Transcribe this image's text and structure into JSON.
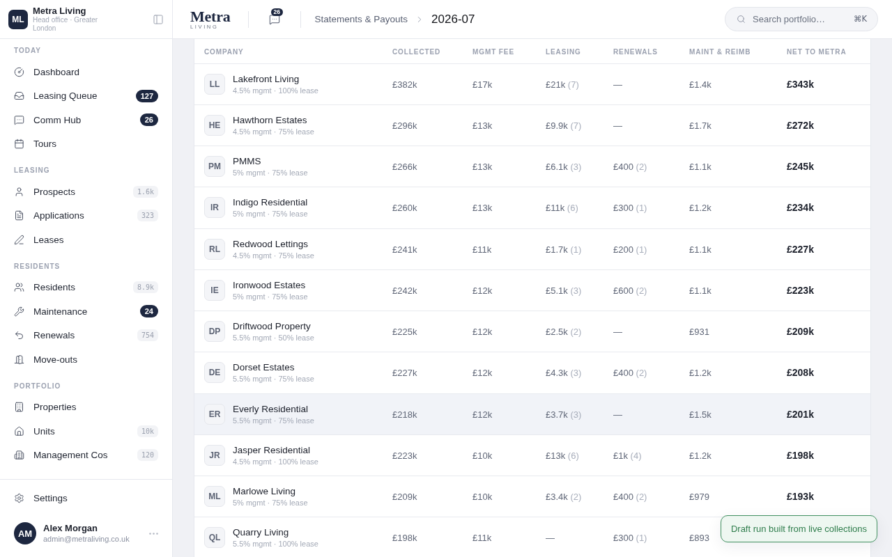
{
  "sidebar": {
    "brand": {
      "initials": "ML",
      "name": "Metra Living",
      "subtitle": "Head office · Greater London"
    },
    "sections": [
      {
        "title": "TODAY",
        "items": [
          {
            "label": "Dashboard",
            "selected": false
          },
          {
            "label": "Leasing Queue",
            "selected": false,
            "badge": {
              "text": "127",
              "kind": "alert"
            }
          },
          {
            "label": "Comm Hub",
            "selected": false,
            "badge": {
              "text": "26",
              "kind": "alert"
            }
          },
          {
            "label": "Tours",
            "selected": false
          }
        ]
      },
      {
        "title": "LEASING",
        "items": [
          {
            "label": "Prospects",
            "selected": false,
            "badge": {
              "text": "1.6k",
              "kind": "count"
            }
          },
          {
            "label": "Applications",
            "selected": false,
            "badge": {
              "text": "323",
              "kind": "count"
            }
          },
          {
            "label": "Leases",
            "selected": false
          }
        ]
      },
      {
        "title": "RESIDENTS",
        "items": [
          {
            "label": "Residents",
            "selected": false,
            "badge": {
              "text": "8.9k",
              "kind": "count"
            }
          },
          {
            "label": "Maintenance",
            "selected": false,
            "badge": {
              "text": "24",
              "kind": "alert"
            }
          },
          {
            "label": "Renewals",
            "selected": false,
            "badge": {
              "text": "754",
              "kind": "count"
            }
          },
          {
            "label": "Move-outs",
            "selected": false
          }
        ]
      },
      {
        "title": "PORTFOLIO",
        "items": [
          {
            "label": "Properties",
            "selected": false
          },
          {
            "label": "Units",
            "selected": false,
            "badge": {
              "text": "10k",
              "kind": "count"
            }
          },
          {
            "label": "Management Cos",
            "selected": false,
            "badge": {
              "text": "120",
              "kind": "count"
            }
          }
        ]
      }
    ],
    "footer_items": [
      {
        "label": "Settings",
        "selected": false
      }
    ],
    "user": {
      "initials": "AM",
      "name": "Alex Morgan",
      "email": "admin@metraliving.co.uk"
    }
  },
  "header": {
    "logo": {
      "name": "Metra",
      "tagline": "LIVING"
    },
    "messages_badge": "26",
    "breadcrumb": [
      {
        "label": "Statements & Payouts",
        "current": false
      },
      {
        "label": "2026-07",
        "current": true
      }
    ],
    "search": {
      "placeholder": "Search portfolio…",
      "shortcut": "⌘K"
    }
  },
  "table": {
    "columns": [
      "COMPANY",
      "COLLECTED",
      "MGMT FEE",
      "LEASING",
      "RENEWALS",
      "MAINT & REIMB",
      "NET TO METRA"
    ],
    "rows": [
      {
        "initials": "LL",
        "name": "Lakefront Living",
        "terms": "4.5% mgmt · 100% lease",
        "collected": "£382k",
        "mgmt_fee": "£17k",
        "leasing": {
          "amount": "£21k",
          "count": "(7)"
        },
        "renewals": {
          "amount": "—"
        },
        "maint_reimb": "£1.4k",
        "net": "£343k",
        "highlighted": false
      },
      {
        "initials": "HE",
        "name": "Hawthorn Estates",
        "terms": "4.5% mgmt · 75% lease",
        "collected": "£296k",
        "mgmt_fee": "£13k",
        "leasing": {
          "amount": "£9.9k",
          "count": "(7)"
        },
        "renewals": {
          "amount": "—"
        },
        "maint_reimb": "£1.7k",
        "net": "£272k",
        "highlighted": false
      },
      {
        "initials": "PM",
        "name": "PMMS",
        "terms": "5% mgmt · 75% lease",
        "collected": "£266k",
        "mgmt_fee": "£13k",
        "leasing": {
          "amount": "£6.1k",
          "count": "(3)"
        },
        "renewals": {
          "amount": "£400",
          "count": "(2)"
        },
        "maint_reimb": "£1.1k",
        "net": "£245k",
        "highlighted": false
      },
      {
        "initials": "IR",
        "name": "Indigo Residential",
        "terms": "5% mgmt · 75% lease",
        "collected": "£260k",
        "mgmt_fee": "£13k",
        "leasing": {
          "amount": "£11k",
          "count": "(6)"
        },
        "renewals": {
          "amount": "£300",
          "count": "(1)"
        },
        "maint_reimb": "£1.2k",
        "net": "£234k",
        "highlighted": false
      },
      {
        "initials": "RL",
        "name": "Redwood Lettings",
        "terms": "4.5% mgmt · 75% lease",
        "collected": "£241k",
        "mgmt_fee": "£11k",
        "leasing": {
          "amount": "£1.7k",
          "count": "(1)"
        },
        "renewals": {
          "amount": "£200",
          "count": "(1)"
        },
        "maint_reimb": "£1.1k",
        "net": "£227k",
        "highlighted": false
      },
      {
        "initials": "IE",
        "name": "Ironwood Estates",
        "terms": "5% mgmt · 75% lease",
        "collected": "£242k",
        "mgmt_fee": "£12k",
        "leasing": {
          "amount": "£5.1k",
          "count": "(3)"
        },
        "renewals": {
          "amount": "£600",
          "count": "(2)"
        },
        "maint_reimb": "£1.1k",
        "net": "£223k",
        "highlighted": false
      },
      {
        "initials": "DP",
        "name": "Driftwood Property",
        "terms": "5.5% mgmt · 50% lease",
        "collected": "£225k",
        "mgmt_fee": "£12k",
        "leasing": {
          "amount": "£2.5k",
          "count": "(2)"
        },
        "renewals": {
          "amount": "—"
        },
        "maint_reimb": "£931",
        "net": "£209k",
        "highlighted": false
      },
      {
        "initials": "DE",
        "name": "Dorset Estates",
        "terms": "5.5% mgmt · 75% lease",
        "collected": "£227k",
        "mgmt_fee": "£12k",
        "leasing": {
          "amount": "£4.3k",
          "count": "(3)"
        },
        "renewals": {
          "amount": "£400",
          "count": "(2)"
        },
        "maint_reimb": "£1.2k",
        "net": "£208k",
        "highlighted": false
      },
      {
        "initials": "ER",
        "name": "Everly Residential",
        "terms": "5.5% mgmt · 75% lease",
        "collected": "£218k",
        "mgmt_fee": "£12k",
        "leasing": {
          "amount": "£3.7k",
          "count": "(3)"
        },
        "renewals": {
          "amount": "—"
        },
        "maint_reimb": "£1.5k",
        "net": "£201k",
        "highlighted": true
      },
      {
        "initials": "JR",
        "name": "Jasper Residential",
        "terms": "4.5% mgmt · 100% lease",
        "collected": "£223k",
        "mgmt_fee": "£10k",
        "leasing": {
          "amount": "£13k",
          "count": "(6)"
        },
        "renewals": {
          "amount": "£1k",
          "count": "(4)"
        },
        "maint_reimb": "£1.2k",
        "net": "£198k",
        "highlighted": false
      },
      {
        "initials": "ML",
        "name": "Marlowe Living",
        "terms": "5% mgmt · 75% lease",
        "collected": "£209k",
        "mgmt_fee": "£10k",
        "leasing": {
          "amount": "£3.4k",
          "count": "(2)"
        },
        "renewals": {
          "amount": "£400",
          "count": "(2)"
        },
        "maint_reimb": "£979",
        "net": "£193k",
        "highlighted": false
      },
      {
        "initials": "QL",
        "name": "Quarry Living",
        "terms": "5.5% mgmt · 100% lease",
        "collected": "£198k",
        "mgmt_fee": "£11k",
        "leasing": {
          "amount": "—"
        },
        "renewals": {
          "amount": "£300",
          "count": "(1)"
        },
        "maint_reimb": "£893",
        "highlighted": false
      }
    ]
  },
  "toast": {
    "message": "Draft run built from live collections",
    "kind": "success"
  }
}
